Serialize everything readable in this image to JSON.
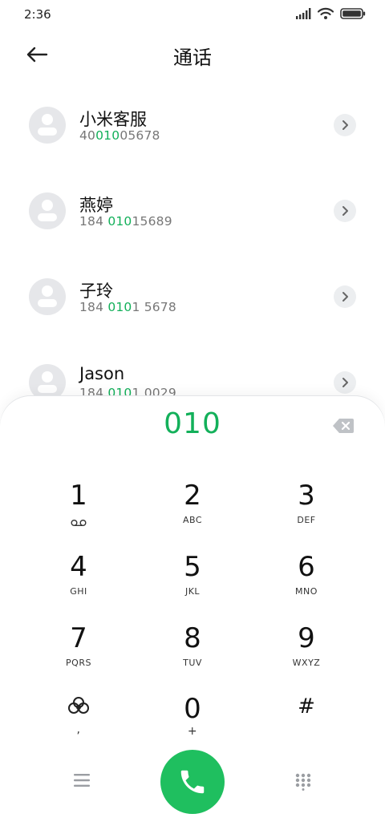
{
  "status_bar": {
    "time": "2:36",
    "icons": [
      "signal-icon",
      "wifi-icon",
      "battery-icon"
    ]
  },
  "header": {
    "title": "通话",
    "back_icon": "back-arrow-icon"
  },
  "contacts": [
    {
      "name": "小米客服",
      "number_prefix": "40",
      "number_match": "010",
      "number_suffix": "05678"
    },
    {
      "name": "燕婷",
      "number_prefix": "184 ",
      "number_match": "010",
      "number_suffix": "15689"
    },
    {
      "name": "子玲",
      "number_prefix": "184 ",
      "number_match": "010",
      "number_suffix": "1 5678"
    },
    {
      "name": "Jason",
      "number_prefix": "184 ",
      "number_match": "010",
      "number_suffix": "1 0029"
    }
  ],
  "dialer": {
    "input_value": "010",
    "keys": [
      {
        "digit": "1",
        "letters": ""
      },
      {
        "digit": "2",
        "letters": "ABC"
      },
      {
        "digit": "3",
        "letters": "DEF"
      },
      {
        "digit": "4",
        "letters": "GHI"
      },
      {
        "digit": "5",
        "letters": "JKL"
      },
      {
        "digit": "6",
        "letters": "MNO"
      },
      {
        "digit": "7",
        "letters": "PQRS"
      },
      {
        "digit": "8",
        "letters": "TUV"
      },
      {
        "digit": "9",
        "letters": "WXYZ"
      },
      {
        "digit": "",
        "letters": ","
      },
      {
        "digit": "0",
        "letters": "+"
      },
      {
        "digit": "#",
        "letters": ""
      }
    ],
    "icons": {
      "voicemail": "voicemail-icon",
      "pause": "flower-icon",
      "backspace": "backspace-icon",
      "menu": "menu-icon",
      "call": "phone-icon",
      "keypad": "keypad-icon"
    }
  },
  "colors": {
    "accent": "#13b05a",
    "call_button": "#1fbf5f",
    "avatar_bg": "#e6e7ea"
  }
}
